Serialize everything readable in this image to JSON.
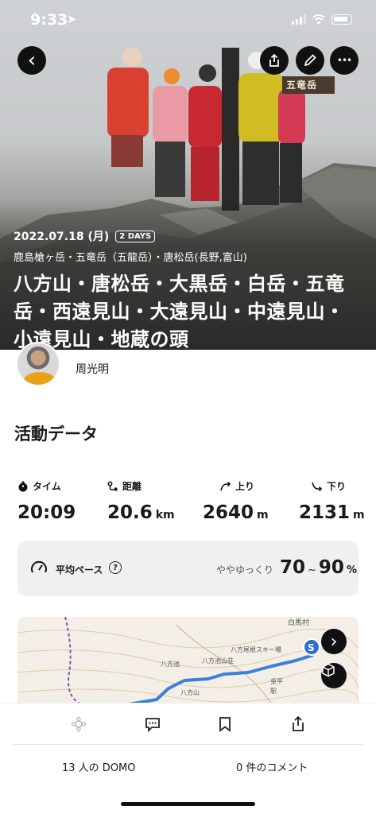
{
  "status_bar": {
    "time": "9:33",
    "location_glyph": "➤"
  },
  "hero": {
    "date": "2022.07.18 (月)",
    "days_badge": "2 DAYS",
    "peaks": "鹿島槍ヶ岳・五竜岳（五龍岳）・唐松岳(長野,富山)",
    "title": "八方山・唐松岳・大黒岳・白岳・五竜岳・西遠見山・大遠見山・中遠見山・小遠見山・地蔵の頭",
    "summit_sign": "五竜岳"
  },
  "header_buttons": {
    "back": "‹",
    "more": "•••"
  },
  "user": {
    "name": "周光明"
  },
  "activity": {
    "section_title": "活動データ",
    "stats": [
      {
        "icon": "stopwatch-icon",
        "label": "タイム",
        "value": "20:09",
        "unit": ""
      },
      {
        "icon": "route-icon",
        "label": "距離",
        "value": "20.6",
        "unit": "km"
      },
      {
        "icon": "ascent-icon",
        "label": "上り",
        "value": "2640",
        "unit": "m"
      },
      {
        "icon": "descent-icon",
        "label": "下り",
        "value": "2131",
        "unit": "m"
      }
    ],
    "pace": {
      "label": "平均ペース",
      "help": "?",
      "description": "ややゆっくり",
      "min": "70",
      "tilde": "~",
      "max": "90",
      "unit": "%"
    }
  },
  "map": {
    "labels": [
      "白馬村",
      "八方尾根スキー場",
      "八方池山荘",
      "八方山",
      "八方池",
      "兎平",
      "駅"
    ]
  },
  "counts": {
    "domo": "13 人の DOMO",
    "comments": "0 件のコメント"
  }
}
